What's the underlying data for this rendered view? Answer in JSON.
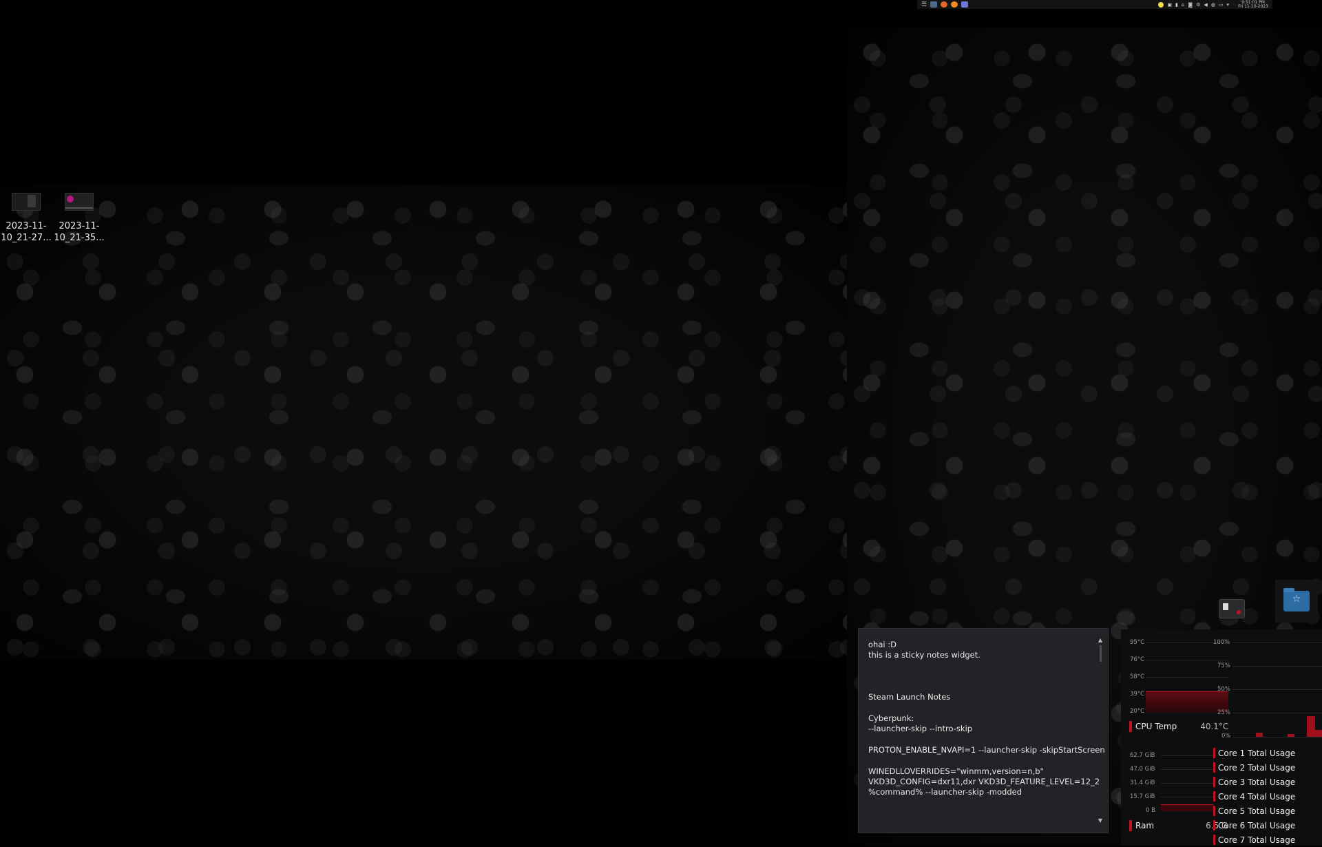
{
  "desktop": {
    "icons": [
      {
        "label_line1": "2023-11-",
        "label_line2": "10_21-27..."
      },
      {
        "label_line1": "2023-11-",
        "label_line2": "10_21-35..."
      }
    ]
  },
  "top_panel": {
    "clock_time": "9:51:01 PM",
    "clock_date": "Fri 11-10-2023"
  },
  "sticky_note": {
    "text": "ohai :D\nthis is a sticky notes widget.\n\n\n\nSteam Launch Notes\n\nCyberpunk:\n--launcher-skip --intro-skip\n\nPROTON_ENABLE_NVAPI=1 --launcher-skip -skipStartScreen\n\nWINEDLLOVERRIDES=\"winmm,version=n,b\"\nVKD3D_CONFIG=dxr11,dxr VKD3D_FEATURE_LEVEL=12_2\n%command% --launcher-skip -modded"
  },
  "system_monitor": {
    "temp_ticks": [
      "95°C",
      "76°C",
      "58°C",
      "39°C",
      "20°C"
    ],
    "usage_ticks": [
      "100%",
      "75%",
      "50%",
      "25%",
      "0%"
    ],
    "cpu_temp_label": "CPU Temp",
    "cpu_temp_value": "40.1°C",
    "ram_ticks": [
      "62.7 GiB",
      "47.0 GiB",
      "31.4 GiB",
      "15.7 GiB",
      "0 B"
    ],
    "ram_label": "Ram",
    "ram_value": "6.5 G",
    "cores": [
      "Core 1 Total Usage",
      "Core 2 Total Usage",
      "Core 3 Total Usage",
      "Core 4 Total Usage",
      "Core 5 Total Usage",
      "Core 6 Total Usage",
      "Core 7 Total Usage"
    ]
  },
  "colors": {
    "accent_red": "#c1121f",
    "folder_blue": "#2e6da4"
  },
  "icons": [
    "menu-icon",
    "files-icon",
    "firefox-icon",
    "firefox-icon",
    "discord-icon",
    "weather-icon",
    "chat-icon",
    "battery-icon",
    "network-icon",
    "volume-icon",
    "display-icon",
    "microphone-icon",
    "monitor-icon",
    "dropdown-arrow-icon",
    "folder-icon",
    "star-folder-icon"
  ]
}
